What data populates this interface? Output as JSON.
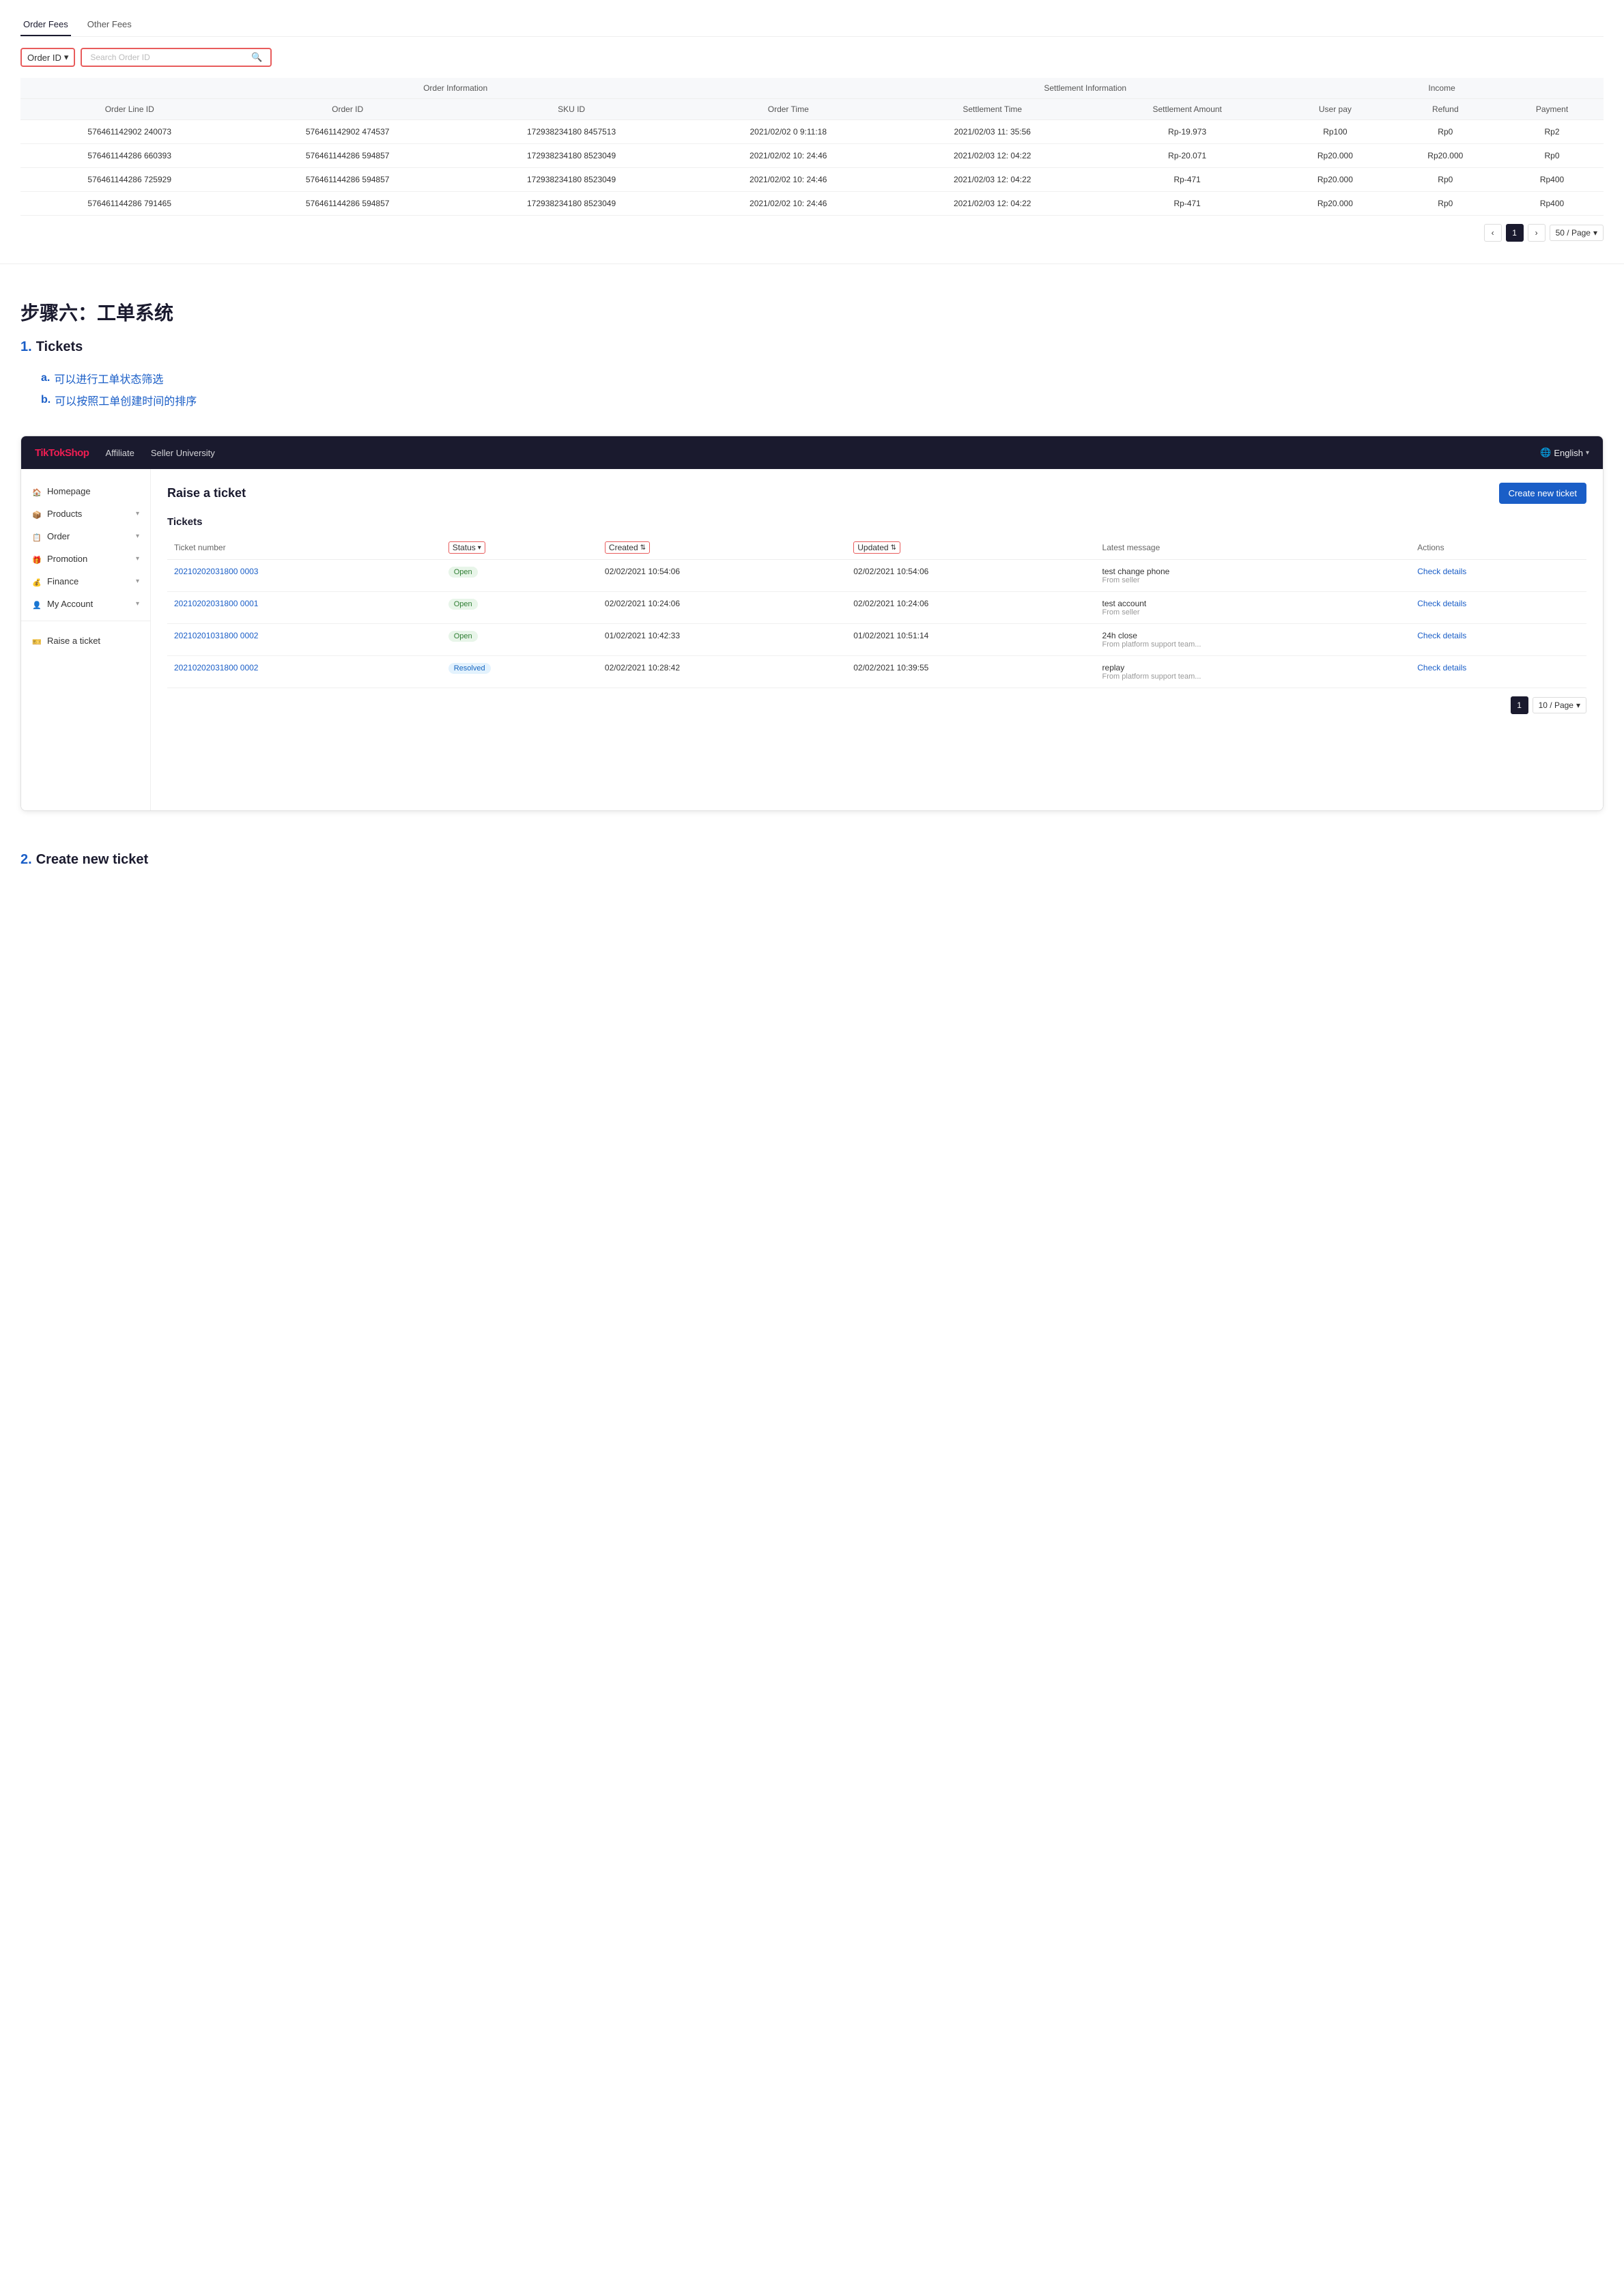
{
  "top": {
    "tabs": [
      "Order Fees",
      "Other Fees"
    ],
    "active_tab": "Order Fees",
    "filter_label": "Order ID",
    "filter_placeholder": "Search Order ID",
    "table": {
      "group_headers": [
        {
          "label": "Order Information",
          "colspan": 4
        },
        {
          "label": "Settlement Information",
          "colspan": 2
        },
        {
          "label": "Income",
          "colspan": 3
        }
      ],
      "headers": [
        "Order Line ID",
        "Order ID",
        "SKU ID",
        "Order Time",
        "Settlement Time",
        "Settlement Amount",
        "User pay",
        "Refund",
        "Payment"
      ],
      "rows": [
        [
          "576461142902 240073",
          "576461142902 474537",
          "172938234180 8457513",
          "2021/02/02 0 9:11:18",
          "2021/02/03 11: 35:56",
          "Rp-19.973",
          "Rp100",
          "Rp0",
          "Rp2"
        ],
        [
          "576461144286 660393",
          "576461144286 594857",
          "172938234180 8523049",
          "2021/02/02 10: 24:46",
          "2021/02/03 12: 04:22",
          "Rp-20.071",
          "Rp20.000",
          "Rp20.000",
          "Rp0"
        ],
        [
          "576461144286 725929",
          "576461144286 594857",
          "172938234180 8523049",
          "2021/02/02 10: 24:46",
          "2021/02/03 12: 04:22",
          "Rp-471",
          "Rp20.000",
          "Rp0",
          "Rp400"
        ],
        [
          "576461144286 791465",
          "576461144286 594857",
          "172938234180 8523049",
          "2021/02/02 10: 24:46",
          "2021/02/03 12: 04:22",
          "Rp-471",
          "Rp20.000",
          "Rp0",
          "Rp400"
        ]
      ]
    },
    "pagination": {
      "current": "1",
      "per_page": "50 / Page"
    }
  },
  "step_section": {
    "title": "步骤六：工单系统",
    "item1_num": "1.",
    "item1_label": "Tickets",
    "sub_items": [
      {
        "alpha": "a.",
        "text": "可以进行工单状态筛选"
      },
      {
        "alpha": "b.",
        "text": "可以按照工单创建时间的排序"
      }
    ]
  },
  "app": {
    "logo_text": "TikTok",
    "logo_shop": "Shop",
    "nav_items": [
      "Affiliate",
      "Seller University"
    ],
    "lang": "English",
    "main_title": "Raise a ticket",
    "create_btn": "Create new ticket",
    "tickets_title": "Tickets",
    "sidebar": {
      "items": [
        {
          "icon": "home",
          "label": "Homepage",
          "has_arrow": false
        },
        {
          "icon": "box",
          "label": "Products",
          "has_arrow": true
        },
        {
          "icon": "order",
          "label": "Order",
          "has_arrow": true
        },
        {
          "icon": "promo",
          "label": "Promotion",
          "has_arrow": true
        },
        {
          "icon": "finance",
          "label": "Finance",
          "has_arrow": true
        },
        {
          "icon": "account",
          "label": "My Account",
          "has_arrow": true
        }
      ],
      "footer_item": {
        "icon": "ticket",
        "label": "Raise a ticket"
      }
    },
    "table": {
      "headers": [
        "Ticket number",
        "Status",
        "Created",
        "Updated",
        "Latest message",
        "Actions"
      ],
      "rows": [
        {
          "ticket_num": "20210202031800 0003",
          "status": "Open",
          "status_type": "open",
          "created": "02/02/2021 10:54:06",
          "updated": "02/02/2021 10:54:06",
          "msg": "test change phone",
          "msg_sub": "From seller",
          "action": "Check details"
        },
        {
          "ticket_num": "20210202031800 0001",
          "status": "Open",
          "status_type": "open",
          "created": "02/02/2021 10:24:06",
          "updated": "02/02/2021 10:24:06",
          "msg": "test account",
          "msg_sub": "From seller",
          "action": "Check details"
        },
        {
          "ticket_num": "20210201031800 0002",
          "status": "Open",
          "status_type": "open",
          "created": "01/02/2021 10:42:33",
          "updated": "01/02/2021 10:51:14",
          "msg": "24h close",
          "msg_sub": "From platform support team...",
          "action": "Check details"
        },
        {
          "ticket_num": "20210202031800 0002",
          "status": "Resolved",
          "status_type": "resolved",
          "created": "02/02/2021 10:28:42",
          "updated": "02/02/2021 10:39:55",
          "msg": "replay",
          "msg_sub": "From platform support team...",
          "action": "Check details"
        }
      ]
    },
    "pagination": {
      "current": "1",
      "per_page": "10 / Page"
    }
  },
  "bottom": {
    "item2_num": "2.",
    "item2_label": "Create new ticket"
  }
}
